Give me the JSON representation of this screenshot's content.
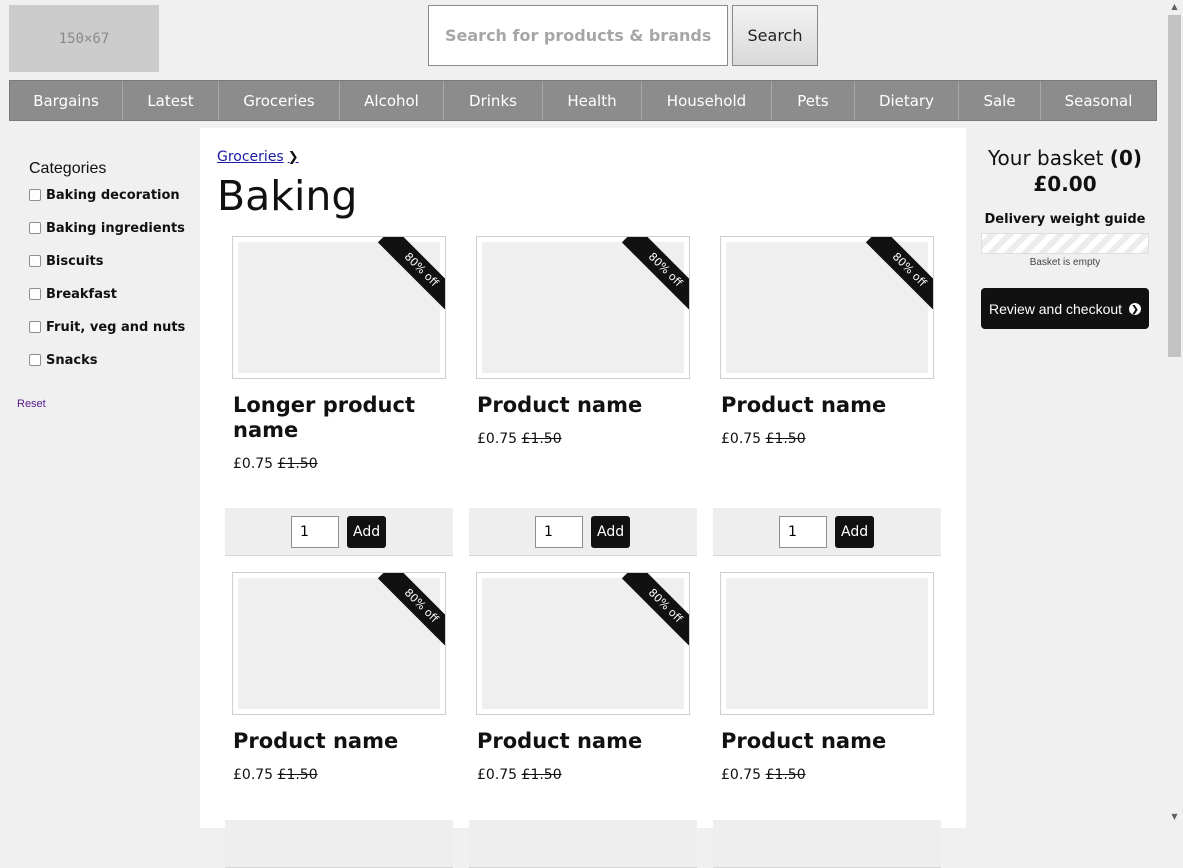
{
  "header": {
    "logo_text": "150×67",
    "search_placeholder": "Search for products & brands",
    "search_button": "Search"
  },
  "nav": {
    "items": [
      "Bargains",
      "Latest",
      "Groceries",
      "Alcohol",
      "Drinks",
      "Health",
      "Household",
      "Pets",
      "Dietary",
      "Sale",
      "Seasonal"
    ]
  },
  "sidebar": {
    "title": "Categories",
    "categories": [
      "Baking decoration",
      "Baking ingredients",
      "Biscuits",
      "Breakfast",
      "Fruit, veg and nuts",
      "Snacks"
    ],
    "reset": "Reset"
  },
  "main": {
    "breadcrumb": "Groceries",
    "title": "Baking",
    "products": [
      {
        "name": "Longer product name",
        "price": "£0.75",
        "old_price": "£1.50",
        "badge": "80% off",
        "qty": "1",
        "add": "Add"
      },
      {
        "name": "Product name",
        "price": "£0.75",
        "old_price": "£1.50",
        "badge": "80% off",
        "qty": "1",
        "add": "Add"
      },
      {
        "name": "Product name",
        "price": "£0.75",
        "old_price": "£1.50",
        "badge": "80% off",
        "qty": "1",
        "add": "Add"
      },
      {
        "name": "Product name",
        "price": "£0.75",
        "old_price": "£1.50",
        "badge": "80% off"
      },
      {
        "name": "Product name",
        "price": "£0.75",
        "old_price": "£1.50",
        "badge": "80% off"
      },
      {
        "name": "Product name",
        "price": "£0.75",
        "old_price": "£1.50",
        "badge": ""
      }
    ]
  },
  "basket": {
    "title": "Your basket",
    "count": "(0)",
    "total": "£0.00",
    "weight_title": "Delivery weight guide",
    "weight_fraction": 0,
    "empty_text": "Basket is empty",
    "checkout": "Review and checkout",
    "checkout_icon": "arrow-circle-right-icon"
  },
  "colors": {
    "nav_background": "#8c8c8c",
    "accent_dark": "#111111",
    "page_background": "#f0f0f0"
  }
}
